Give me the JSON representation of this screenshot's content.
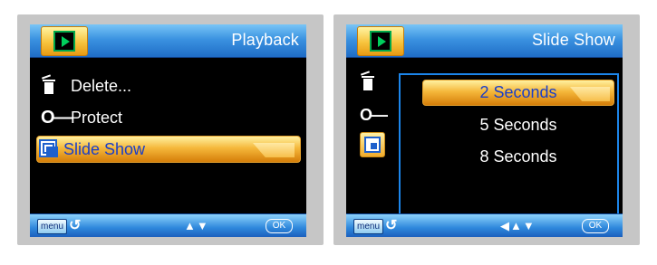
{
  "left": {
    "title": "Playback",
    "items": [
      {
        "icon": "trash-icon",
        "label": "Delete..."
      },
      {
        "icon": "key-icon",
        "label": "Protect"
      },
      {
        "icon": "slide-show-icon",
        "label": "Slide Show"
      }
    ],
    "footer": {
      "menu": "menu",
      "back": "↺",
      "arrows": "▲▼",
      "ok": "OK"
    }
  },
  "right": {
    "title": "Slide Show",
    "options": [
      {
        "label": "2 Seconds",
        "selected": true
      },
      {
        "label": "5 Seconds",
        "selected": false
      },
      {
        "label": "8 Seconds",
        "selected": false
      }
    ],
    "footer": {
      "menu": "menu",
      "back": "↺",
      "arrows": "◀▲▼",
      "ok": "OK"
    }
  },
  "colors": {
    "accent": "#f5b83b",
    "bar": "#3b93e1",
    "selected_text": "#1a3fc9"
  }
}
